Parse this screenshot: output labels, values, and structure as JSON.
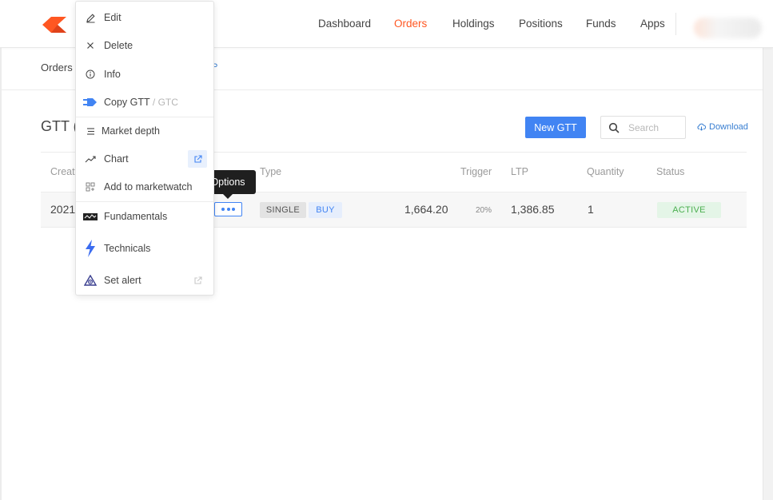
{
  "colors": {
    "accent": "#ff5722",
    "primary": "#4184f3",
    "link": "#387ed1",
    "success": "#4caf50"
  },
  "header": {
    "logo": "kite-logo",
    "nav": [
      "Dashboard",
      "Orders",
      "Holdings",
      "Positions",
      "Funds",
      "Apps"
    ],
    "active_nav": "Orders"
  },
  "subnav": {
    "first": "Orders",
    "tail": "P"
  },
  "page": {
    "title": "GTT (",
    "new_button": "New GTT",
    "search_placeholder": "Search",
    "download_label": "Download"
  },
  "table": {
    "headers": {
      "created": "Creat",
      "type": "Type",
      "trigger": "Trigger",
      "ltp": "LTP",
      "quantity": "Quantity",
      "status": "Status"
    },
    "row": {
      "created": "2021",
      "type_tag": "SINGLE",
      "side_tag": "BUY",
      "trigger": "1,664.20",
      "trigger_pct": "20%",
      "ltp": "1,386.85",
      "quantity": "1",
      "status": "ACTIVE"
    }
  },
  "tooltip": "Options",
  "menu": {
    "edit": "Edit",
    "delete": "Delete",
    "info": "Info",
    "copy": "Copy GTT",
    "copy_sub": "/ GTC",
    "market_depth": "Market depth",
    "chart": "Chart",
    "add_watch": "Add to marketwatch",
    "fundamentals": "Fundamentals",
    "technicals": "Technicals",
    "set_alert": "Set alert"
  }
}
